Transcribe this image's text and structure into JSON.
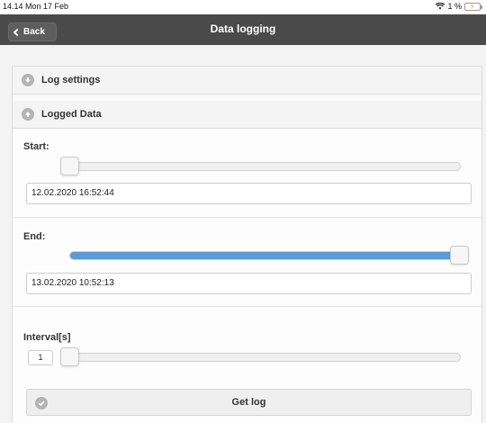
{
  "status_bar": {
    "time": "14.14  Mon 17 Feb",
    "battery": "1 %"
  },
  "header": {
    "back_label": "Back",
    "title": "Data logging"
  },
  "log_settings": {
    "label": "Log settings",
    "icon": "chevron-down-circle-icon"
  },
  "logged_data": {
    "label": "Logged Data",
    "icon": "chevron-up-circle-icon",
    "start": {
      "label": "Start:",
      "value": "12.02.2020 16:52:44",
      "slider_level": 0.0
    },
    "end": {
      "label": "End:",
      "value": "13.02.2020 10:52:13",
      "slider_level": 1.0
    },
    "interval": {
      "label": "Interval[s]",
      "value": "1",
      "slider_level": 0.0
    },
    "get_log": {
      "label": "Get log",
      "icon": "check-circle-icon"
    }
  },
  "colors": {
    "header": "#4a4a4a",
    "slider_fill": "#5a9bd8",
    "icon_grey": "#b4b4b4"
  }
}
